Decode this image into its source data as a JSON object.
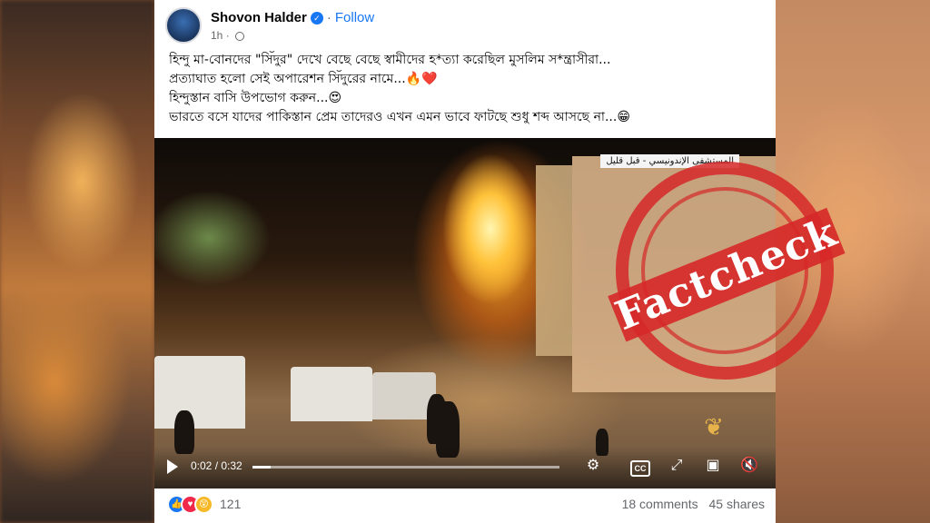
{
  "post": {
    "author": "Shovon Halder",
    "separator": "·",
    "follow_label": "Follow",
    "time": "1h",
    "lines": [
      "হিন্দু মা-বোনদের \"সিঁদুর\" দেখে বেছে বেছে স্বামীদের হ*ত্যা করেছিল মুসলিম স*ন্ত্রাসীরা...",
      "প্রত্যাঘাত হলো সেই অপারেশন সিঁদুরের নামে...🔥❤️",
      "হিন্দুস্তান বাসি উপভোগ করুন...😍",
      "ভারতে বসে যাদের পাকিস্তান প্রেম তাদেরও এখন এমন ভাবে ফাটছে শুধু শব্দ আসছে না...😁"
    ]
  },
  "video": {
    "channel_banner": "المستشفى الإندونيسي - قبل قليل",
    "current_time": "0:02",
    "duration": "0:32",
    "time_display": "0:02 / 0:32",
    "progress_fraction": 0.06
  },
  "footer": {
    "reaction_count": "121",
    "comments": "18 comments",
    "shares": "45 shares"
  },
  "stamp": {
    "text": "Factcheck"
  },
  "icons": {
    "verified": "verified-badge-icon",
    "globe": "globe-icon",
    "play": "play-icon",
    "settings": "gear-icon",
    "captions": "cc-icon",
    "fullscreen_expand": "expand-icon",
    "pip": "picture-in-picture-icon",
    "volume": "mute-icon"
  },
  "colors": {
    "accent": "#1877f2",
    "stamp": "#d62828"
  }
}
